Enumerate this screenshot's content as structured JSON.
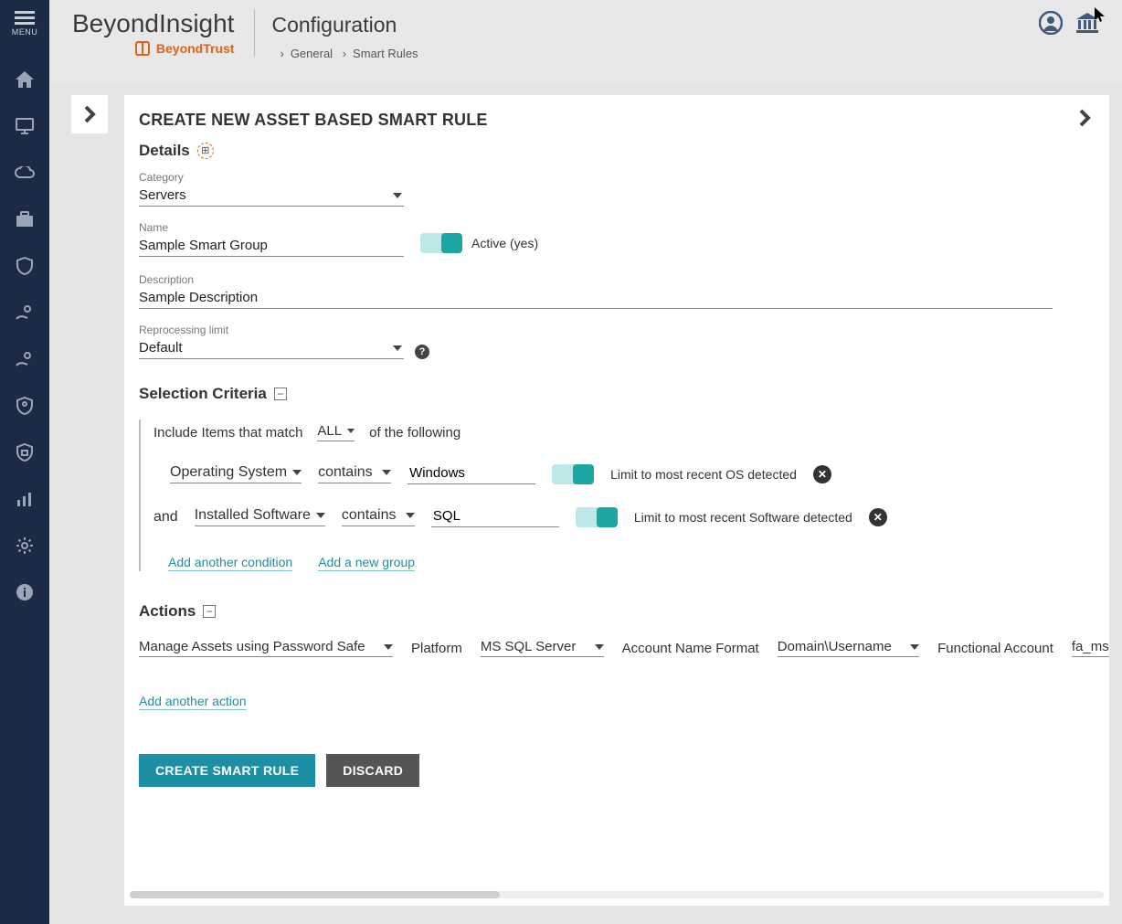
{
  "sidebar": {
    "menu_label": "MENU"
  },
  "header": {
    "brand": "BeyondInsight",
    "brand_sub": "BeyondTrust",
    "page_title": "Configuration",
    "breadcrumb1": "General",
    "breadcrumb2": "Smart Rules"
  },
  "panel": {
    "title": "CREATE NEW ASSET BASED SMART RULE"
  },
  "sections": {
    "details_title": "Details",
    "criteria_title": "Selection Criteria",
    "actions_title": "Actions"
  },
  "details": {
    "category_label": "Category",
    "category_value": "Servers",
    "name_label": "Name",
    "name_value": "Sample Smart Group",
    "active_label": "Active (yes)",
    "description_label": "Description",
    "description_value": "Sample Description",
    "reproc_label": "Reprocessing limit",
    "reproc_value": "Default"
  },
  "criteria": {
    "include_prefix": "Include Items that match",
    "match_mode": "ALL",
    "include_suffix": "of the following",
    "and_label": "and",
    "cond1_type": "Operating System",
    "cond1_op": "contains",
    "cond1_value": "Windows",
    "cond1_toggle_label": "Limit to most recent OS detected",
    "cond2_type": "Installed Software",
    "cond2_op": "contains",
    "cond2_value": "SQL",
    "cond2_toggle_label": "Limit to most recent Software detected",
    "add_condition": "Add another condition",
    "add_group": "Add a new group"
  },
  "actions": {
    "action_type": "Manage Assets using Password Safe",
    "platform_label": "Platform",
    "platform_value": "MS SQL Server",
    "account_fmt_label": "Account Name Format",
    "account_fmt_value": "Domain\\Username",
    "func_acct_label": "Functional Account",
    "func_acct_value": "fa_mssql",
    "add_action": "Add another action"
  },
  "buttons": {
    "create": "CREATE SMART RULE",
    "discard": "DISCARD"
  }
}
